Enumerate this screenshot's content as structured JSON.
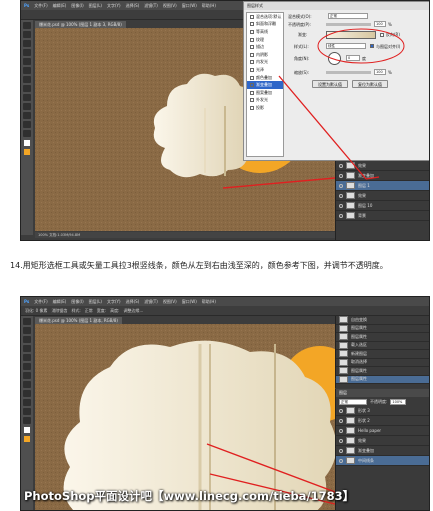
{
  "screenshot1": {
    "menu": [
      "Ps",
      "文件(F)",
      "编辑(E)",
      "图像(I)",
      "图层(L)",
      "文字(Y)",
      "选择(S)",
      "滤镜(T)",
      "视图(V)",
      "窗口(W)",
      "帮助(H)"
    ],
    "doc_tab": "爆米花.psd @ 100% (图层 1 副本 3, RGB/8)",
    "status": "100%  文档:1.03M/94.8M",
    "dialog": {
      "title": "图层样式",
      "style_items": [
        {
          "label": "混合选项:默认",
          "checked": false,
          "active": false
        },
        {
          "label": "斜面和浮雕",
          "checked": false,
          "active": false
        },
        {
          "label": "等高线",
          "checked": false,
          "active": false
        },
        {
          "label": "纹理",
          "checked": false,
          "active": false
        },
        {
          "label": "描边",
          "checked": false,
          "active": false
        },
        {
          "label": "内阴影",
          "checked": false,
          "active": false
        },
        {
          "label": "内发光",
          "checked": false,
          "active": false
        },
        {
          "label": "光泽",
          "checked": false,
          "active": false
        },
        {
          "label": "颜色叠加",
          "checked": false,
          "active": false
        },
        {
          "label": "渐变叠加",
          "checked": true,
          "active": true
        },
        {
          "label": "图案叠加",
          "checked": false,
          "active": false
        },
        {
          "label": "外发光",
          "checked": false,
          "active": false
        },
        {
          "label": "投影",
          "checked": false,
          "active": false
        }
      ],
      "blend_label": "混合模式(O):",
      "blend_value": "正常",
      "opacity_label": "不透明度(P):",
      "opacity_value": "100",
      "gradient_label": "渐变:",
      "reverse_label": "反向(R)",
      "style_label": "样式(L):",
      "style_value": "线性",
      "align_label": "与图层对齐(I)",
      "angle_label": "角度(N):",
      "angle_value": "0",
      "degree_unit": "度",
      "scale_label": "缩放(S):",
      "scale_value": "100",
      "percent_unit": "%",
      "default_btn": "设置为默认值",
      "reset_btn": "复位为默认值"
    },
    "layers": [
      {
        "name": "效果",
        "sel": false
      },
      {
        "name": "渐变叠加",
        "sel": false
      },
      {
        "name": "图层 1",
        "sel": true
      },
      {
        "name": "效果",
        "sel": false
      },
      {
        "name": "图层 10",
        "sel": false
      },
      {
        "name": "背景",
        "sel": false
      }
    ]
  },
  "caption": "14.用矩形选框工具或矢量工具拉3根竖线条，颜色从左到右由浅至深的，颜色参考下图，并调节不透明度。",
  "screenshot2": {
    "menu": [
      "Ps",
      "文件(F)",
      "编辑(E)",
      "图像(I)",
      "图层(L)",
      "文字(Y)",
      "选择(S)",
      "滤镜(T)",
      "视图(V)",
      "窗口(W)",
      "帮助(H)"
    ],
    "options": [
      "羽化: 0 像素",
      "消除锯齿",
      "样式:",
      "正常",
      "宽度:",
      "高度:",
      "调整边缘..."
    ],
    "doc_tab": "爆米花.psd @ 100% (图层 1 副本, RGB/8)",
    "history_items": [
      "自由变换",
      "图层属性",
      "图层属性",
      "载入选区",
      "新建图层",
      "取消选择",
      "图层属性",
      "图层属性"
    ],
    "layers_panel_title": "图层",
    "layer_mode": "正常",
    "layer_opacity_label": "不透明度:",
    "layer_opacity": "100%",
    "layers": [
      {
        "name": "形状 3",
        "sel": false
      },
      {
        "name": "形状 2",
        "sel": false
      },
      {
        "name": "Hello paper",
        "sel": false
      },
      {
        "name": "效果",
        "sel": false
      },
      {
        "name": "渐变叠加",
        "sel": false
      },
      {
        "name": "中间线条",
        "sel": true
      }
    ]
  },
  "watermark": "PhotoShop平面设计吧【www.linecg.com/tieba/1783】",
  "colors": {
    "canvas": "#8a6a45",
    "accent": "#f3a626",
    "selection": "#2f66c8",
    "arrow": "#e02020"
  }
}
